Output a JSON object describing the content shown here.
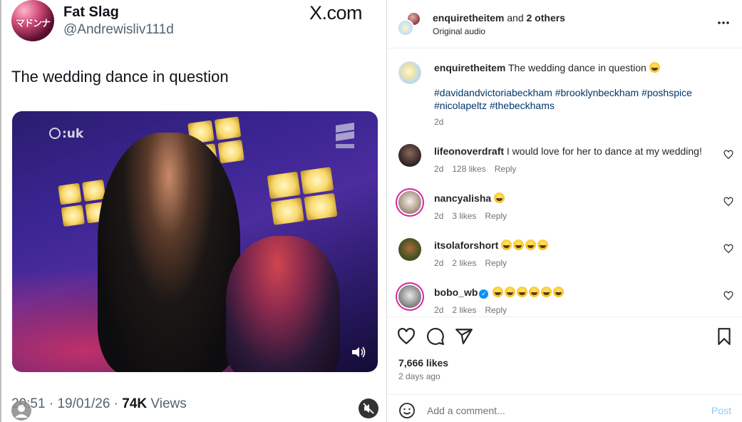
{
  "tweet": {
    "display_name": "Fat Slag",
    "handle": "@Andrewisliv111d",
    "avatar_text": "マドンナ",
    "brand": "X.com",
    "text": "The wedding dance in question",
    "video": {
      "channel_logo_text": ":uk",
      "volume_icon": "volume-icon"
    },
    "time": "20:51",
    "separator": " · ",
    "date": "19/01/26",
    "views_count": "74K",
    "views_label": " Views"
  },
  "instagram": {
    "header": {
      "username": "enquiretheitem",
      "and_text": " and ",
      "others": "2 others",
      "audio": "Original audio",
      "more_icon": "more-icon"
    },
    "caption": {
      "username": "enquiretheitem",
      "text": " The wedding dance in question",
      "hashtags": "#davidandvictoriabeckham #brooklynbeckham #poshspice #nicolapeltz #thebeckhams",
      "time": "2d"
    },
    "comments": [
      {
        "username": "lifeonoverdraft",
        "text": " I would love for her to dance at my wedding!",
        "time": "2d",
        "likes": "128 likes",
        "reply": "Reply",
        "emoji_count": 0,
        "verified": false,
        "avatar_color": "#3a2a2a"
      },
      {
        "username": "nancyalisha",
        "text": " ",
        "time": "2d",
        "likes": "3 likes",
        "reply": "Reply",
        "emoji_count": 1,
        "verified": false,
        "avatar_color": "#6b5a4a"
      },
      {
        "username": "itsolaforshort",
        "text": " ",
        "time": "2d",
        "likes": "2 likes",
        "reply": "Reply",
        "emoji_count": 4,
        "verified": false,
        "avatar_color": "#3f4a2a"
      },
      {
        "username": "bobo_wb",
        "text": " ",
        "time": "2d",
        "likes": "2 likes",
        "reply": "Reply",
        "emoji_count": 6,
        "verified": true,
        "avatar_color": "#7a7a7a"
      }
    ],
    "likes": "7,666 likes",
    "ago": "2 days ago",
    "add_comment_placeholder": "Add a comment...",
    "post_label": "Post"
  },
  "colors": {
    "link": "#00376b",
    "post_disabled": "#8cc9f7",
    "muted": "#737373",
    "verified": "#0095f6"
  }
}
